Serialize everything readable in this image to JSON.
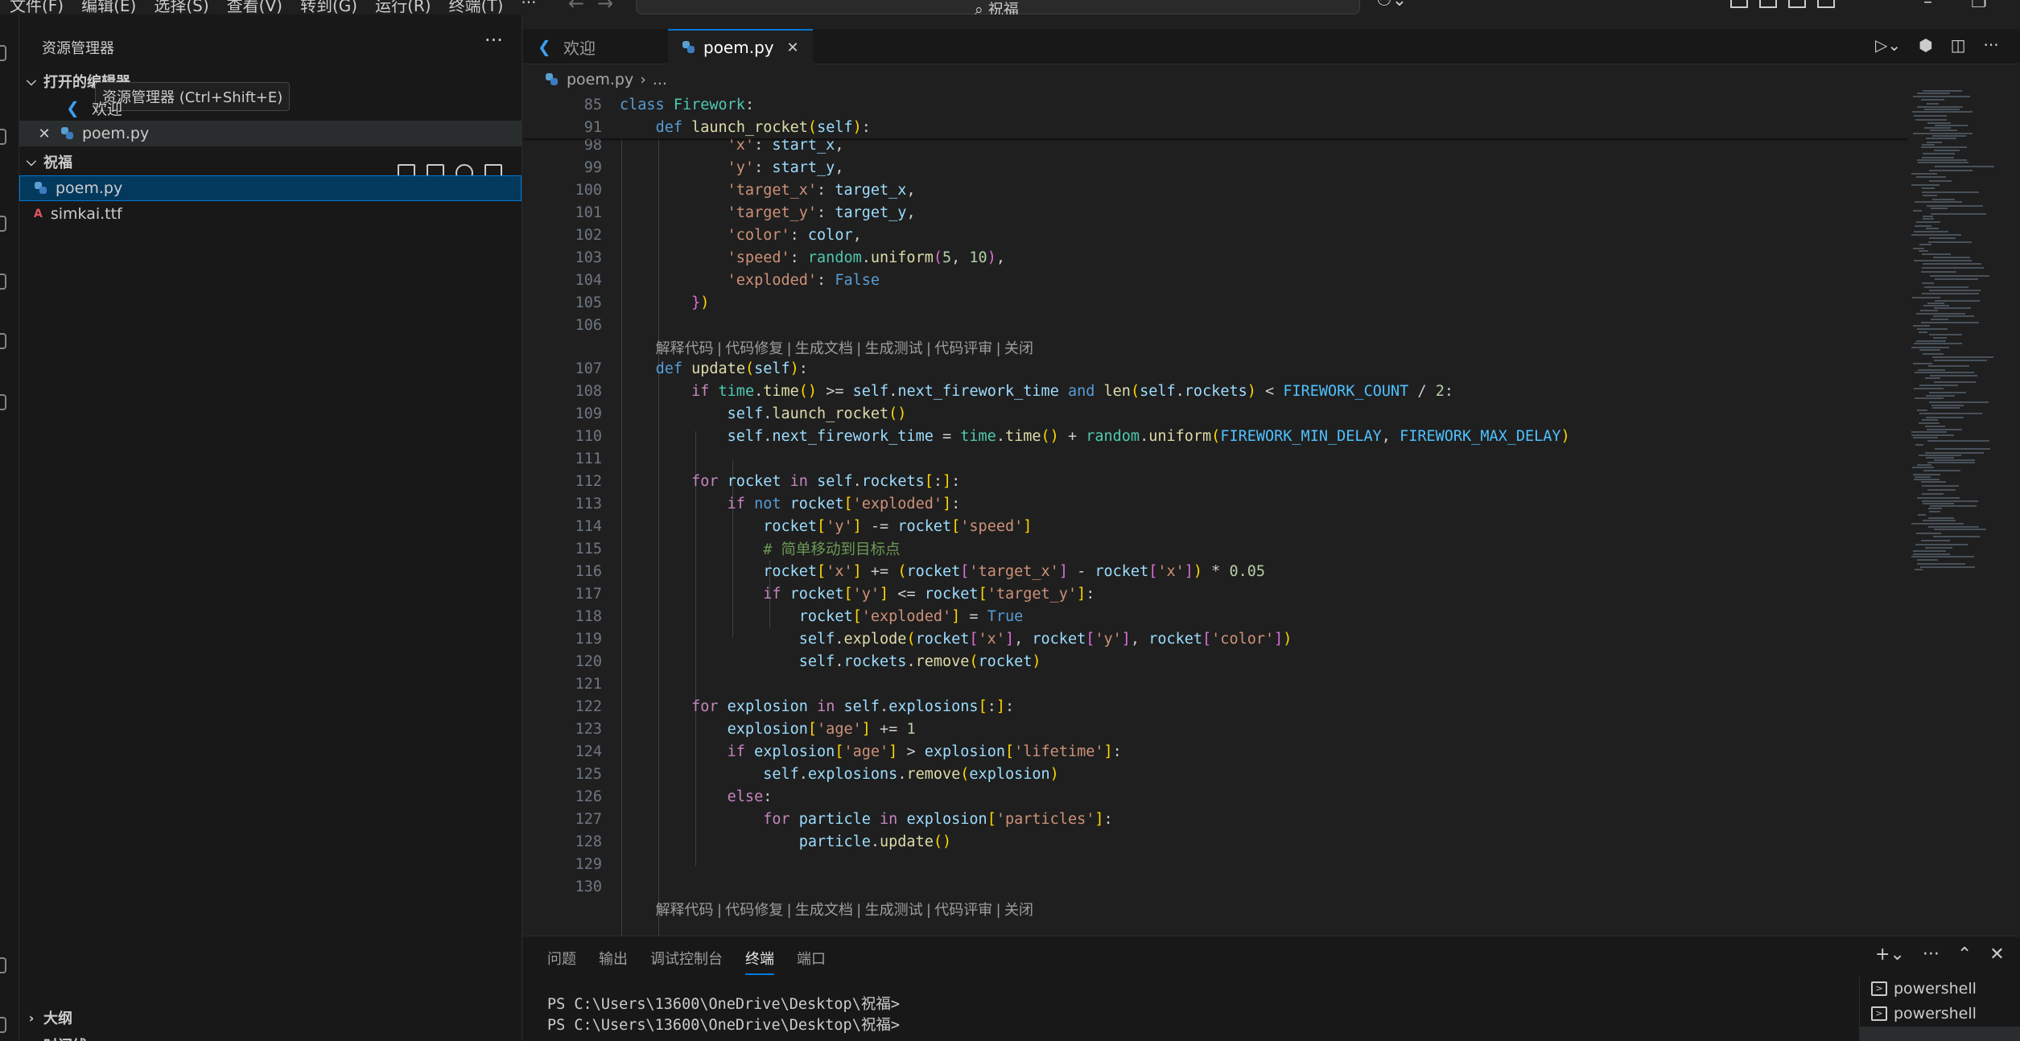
{
  "menu": [
    "文件(F)",
    "编辑(E)",
    "选择(S)",
    "查看(V)",
    "转到(G)",
    "运行(R)",
    "终端(T)",
    "···"
  ],
  "search": {
    "text": "祝福"
  },
  "sidebar": {
    "title": "资源管理器",
    "open_editors_label": "打开的编辑器",
    "tooltip": "资源管理器 (Ctrl+Shift+E)",
    "open_editors": [
      {
        "label": "欢迎",
        "icon": "vscode-icon"
      },
      {
        "label": "poem.py",
        "icon": "python-icon"
      }
    ],
    "folder_label": "祝福",
    "files": [
      {
        "label": "poem.py",
        "icon": "python-icon"
      },
      {
        "label": "simkai.ttf",
        "icon": "font-icon"
      }
    ],
    "outline_label": "大纲",
    "timeline_label": "时间线"
  },
  "tabs": [
    {
      "label": "欢迎",
      "icon": "vscode-icon"
    },
    {
      "label": "poem.py",
      "icon": "python-icon",
      "active": true
    }
  ],
  "breadcrumb": {
    "file": "poem.py",
    "rest": "..."
  },
  "code_lens": "解释代码 | 代码修复 | 生成文档 | 生成测试 | 代码评审 | 关闭",
  "line_numbers": [
    "85",
    "91",
    "98",
    "99",
    "100",
    "101",
    "102",
    "103",
    "104",
    "105",
    "106",
    "",
    "107",
    "108",
    "109",
    "110",
    "111",
    "112",
    "113",
    "114",
    "115",
    "116",
    "117",
    "118",
    "119",
    "120",
    "121",
    "122",
    "123",
    "124",
    "125",
    "126",
    "127",
    "128",
    "129",
    "130",
    ""
  ],
  "panel": {
    "tabs": [
      "问题",
      "输出",
      "调试控制台",
      "终端",
      "端口"
    ],
    "active_tab": "终端",
    "terminal_lines": [
      "PS C:\\Users\\13600\\OneDrive\\Desktop\\祝福>",
      "PS C:\\Users\\13600\\OneDrive\\Desktop\\祝福>"
    ],
    "terminals": [
      "powershell",
      "powershell"
    ]
  },
  "colors": {
    "accent": "#0078d4",
    "selection": "#04395e"
  }
}
